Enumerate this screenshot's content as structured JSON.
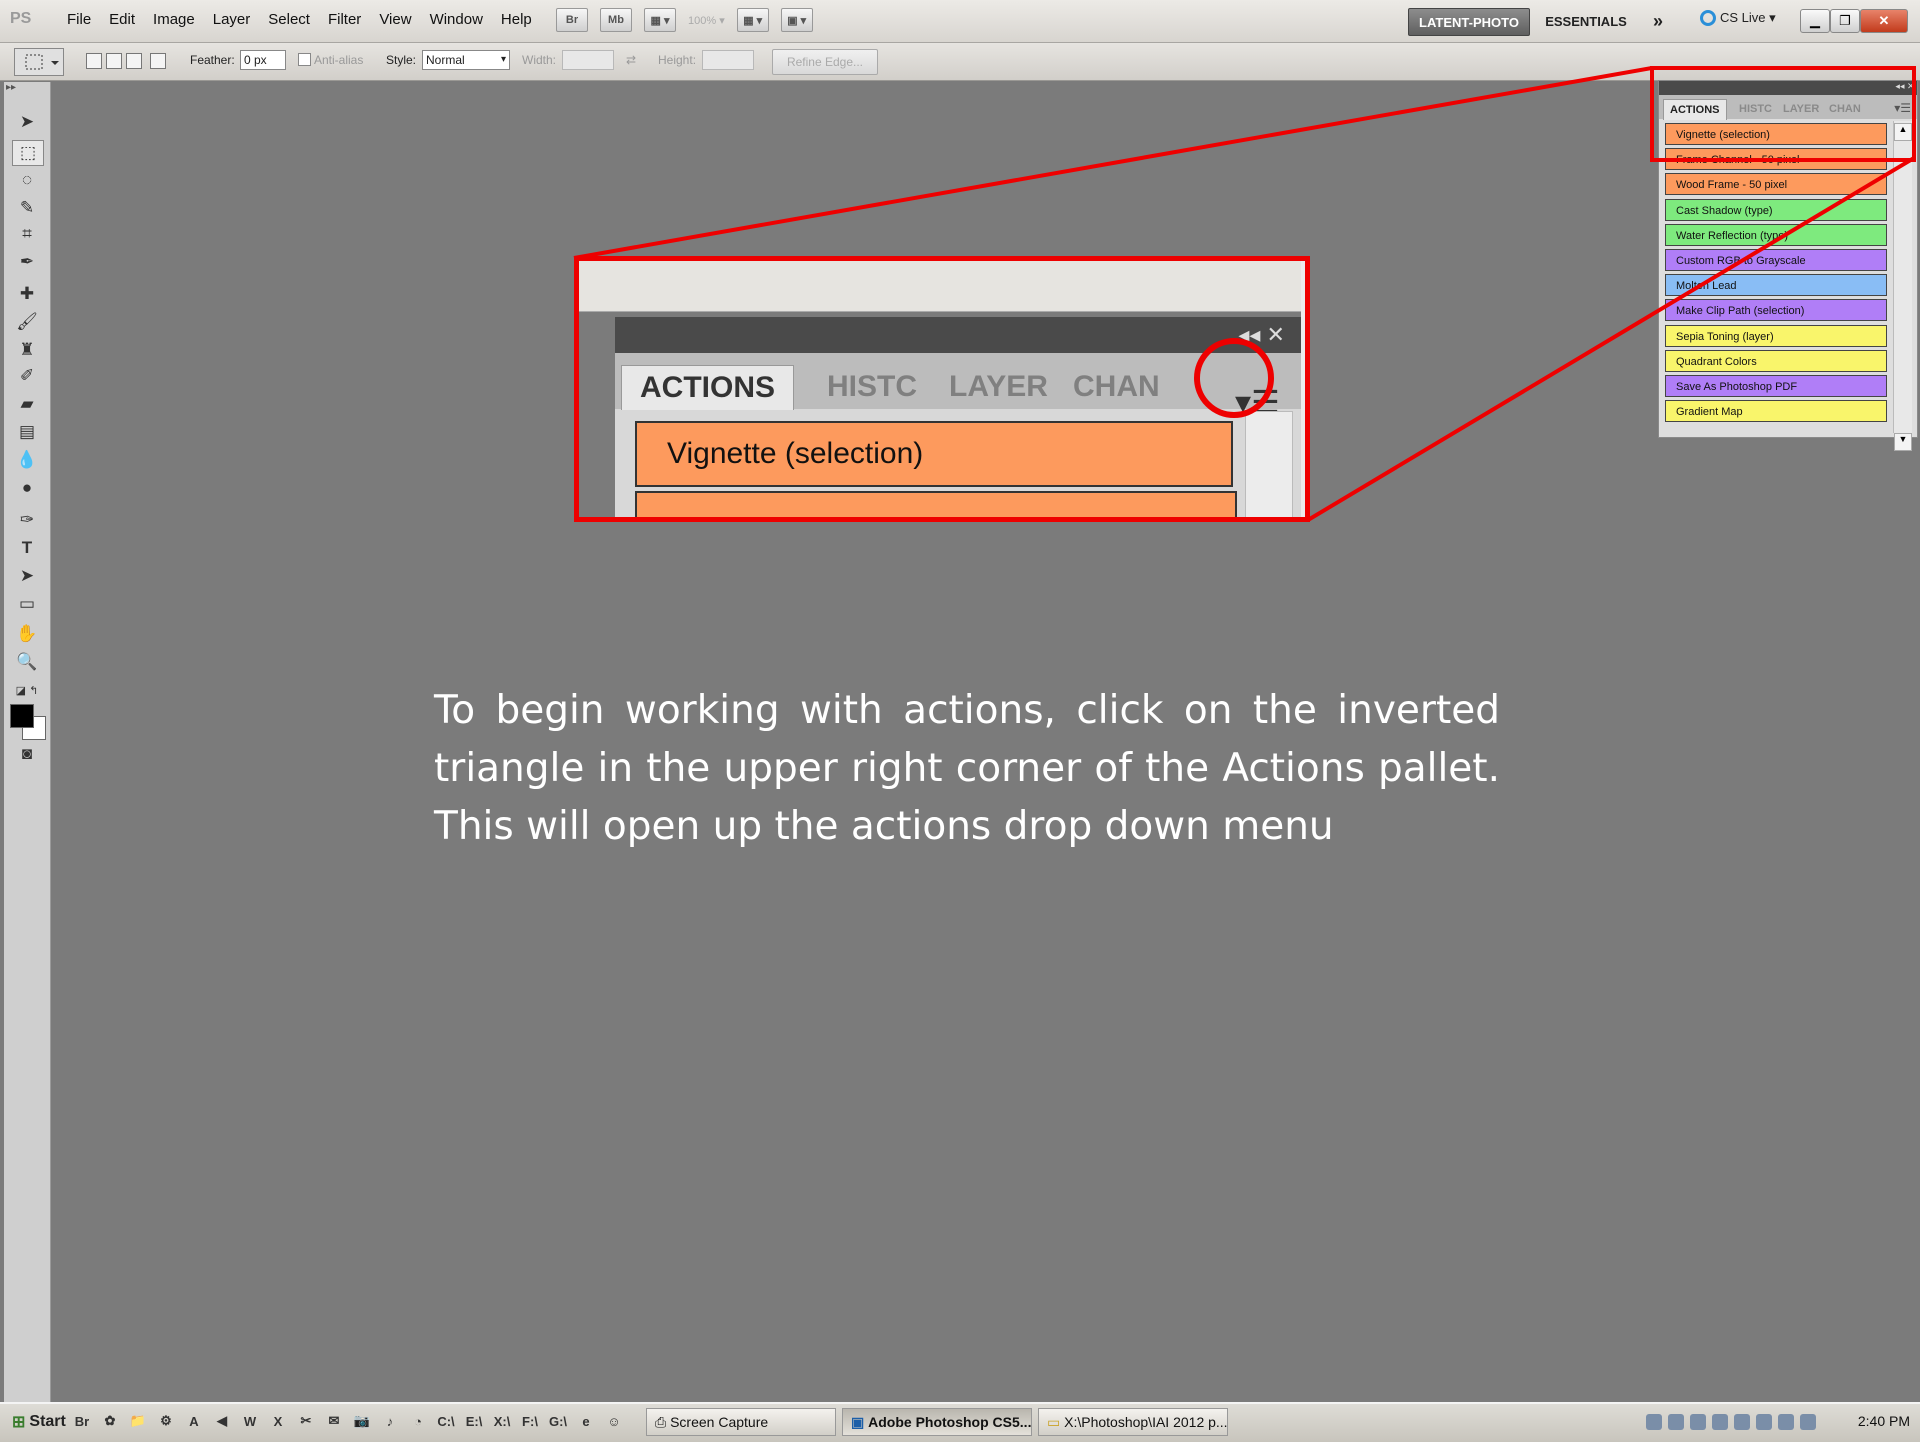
{
  "menubar": {
    "logo": "PS",
    "items": [
      "File",
      "Edit",
      "Image",
      "Layer",
      "Select",
      "Filter",
      "View",
      "Window",
      "Help"
    ],
    "app_icons": [
      "Br",
      "Mb",
      "▦ ▾",
      "100% ▾",
      "▦ ▾",
      "▣ ▾"
    ],
    "workspaces": {
      "active": "LATENT-PHOTO",
      "other": "ESSENTIALS",
      "more": "»"
    },
    "cslive": "CS Live ▾"
  },
  "options": {
    "feather_label": "Feather:",
    "feather_value": "0 px",
    "antialias_label": "Anti-alias",
    "style_label": "Style:",
    "style_value": "Normal",
    "width_label": "Width:",
    "height_label": "Height:",
    "refine_edge": "Refine Edge..."
  },
  "panel": {
    "tabs": {
      "active": "ACTIONS",
      "inactive": [
        "HISTC",
        "LAYER",
        "CHAN"
      ]
    },
    "actions": [
      {
        "label": "Vignette (selection)",
        "color": "#fd9a5d"
      },
      {
        "label": "Frame Channel - 50 pixel",
        "color": "#fd9a5d"
      },
      {
        "label": "Wood Frame - 50 pixel",
        "color": "#fd9a5d"
      },
      {
        "label": "Cast Shadow (type)",
        "color": "#7eea7e"
      },
      {
        "label": "Water Reflection (type)",
        "color": "#7eea7e"
      },
      {
        "label": "Custom RGB to Grayscale",
        "color": "#b07ef7"
      },
      {
        "label": "Molten Lead",
        "color": "#89bdf5"
      },
      {
        "label": "Make Clip Path (selection)",
        "color": "#b07ef7"
      },
      {
        "label": "Sepia Toning (layer)",
        "color": "#f9f56b"
      },
      {
        "label": "Quadrant Colors",
        "color": "#f9f56b"
      },
      {
        "label": "Save As Photoshop PDF",
        "color": "#b07ef7"
      },
      {
        "label": "Gradient Map",
        "color": "#f9f56b"
      }
    ]
  },
  "zoom": {
    "head_controls": "◂◂  ✕",
    "tabs": {
      "active": "ACTIONS",
      "inactive": [
        "HISTC",
        "LAYER",
        "CHAN"
      ]
    },
    "menu_icon": "▾☰",
    "first_action": "Vignette (selection)"
  },
  "instruction": "To begin working with actions, click on the inverted triangle in the upper right corner of the Actions pallet. This will open up the actions drop down menu",
  "taskbar": {
    "start": "Start",
    "quick_launch": [
      "Br",
      "✿",
      "📁",
      "⚙",
      "A",
      "◀",
      "W",
      "X",
      "✂",
      "✉",
      "📷",
      "♪",
      "◔",
      "C:\\",
      "E:\\",
      "X:\\",
      "F:\\",
      "G:\\",
      "e",
      "☺"
    ],
    "tasks": [
      {
        "label": "Screen Capture",
        "active": false
      },
      {
        "label": "Adobe Photoshop CS5...",
        "active": true
      },
      {
        "label": "X:\\Photoshop\\IAI 2012 p...",
        "active": false
      }
    ],
    "clock": "2:40 PM"
  }
}
